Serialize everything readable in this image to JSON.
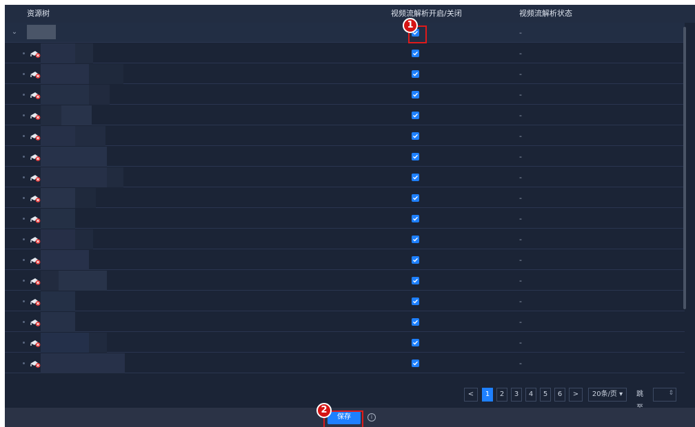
{
  "header": {
    "resource_tree": "资源树",
    "switch_col": "视频流解析开启/关闭",
    "status_col": "视频流解析状态"
  },
  "rows": {
    "status_placeholder": "-",
    "root_checked": true,
    "child_count": 16,
    "child_checked": true
  },
  "markers": [
    "1",
    "2"
  ],
  "pagination": {
    "prev": "<",
    "pages": [
      "1",
      "2",
      "3",
      "4",
      "5",
      "6"
    ],
    "active_page": "1",
    "next": ">",
    "page_size": "20条/页",
    "jump_label": "跳至",
    "jump_value": ""
  },
  "footer": {
    "save_label": "保存",
    "info_icon": "i"
  },
  "colors": {
    "accent": "#1e80ff",
    "highlight": "#e01a1a",
    "background": "#1b2436"
  },
  "icons": [
    "chevron-down-icon",
    "camera-offline-icon",
    "check-icon",
    "info-icon",
    "chevron-left-icon",
    "chevron-right-icon"
  ]
}
